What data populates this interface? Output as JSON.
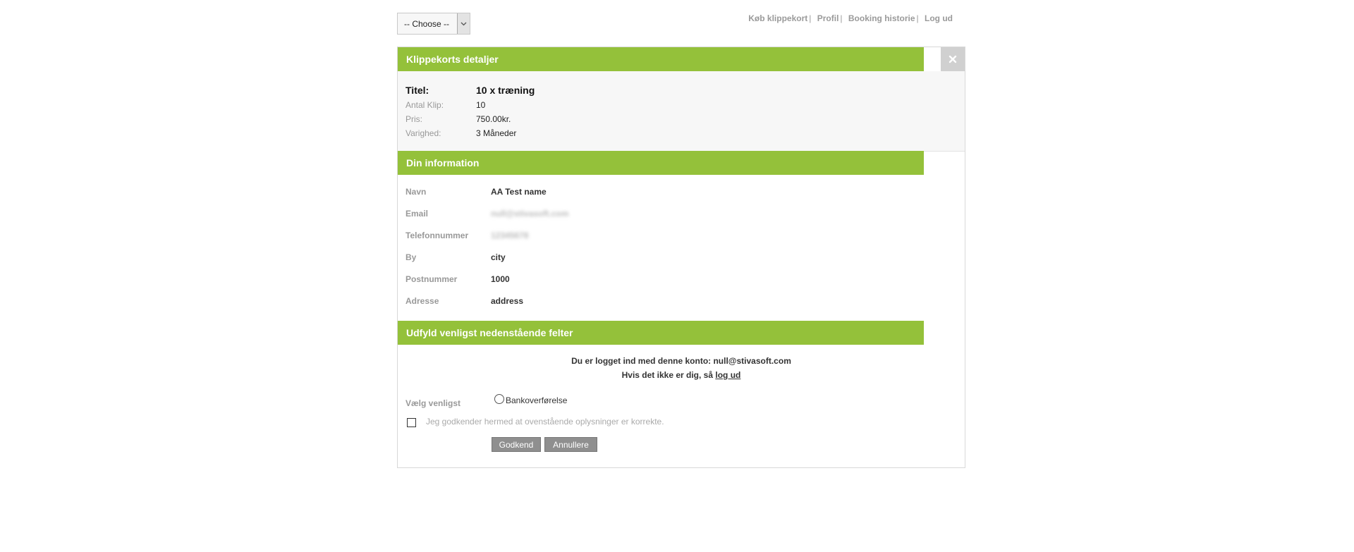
{
  "select": {
    "value": "-- Choose --"
  },
  "nav": {
    "items": [
      {
        "label": "Køb klippekort"
      },
      {
        "label": "Profil"
      },
      {
        "label": "Booking historie"
      },
      {
        "label": "Log ud"
      }
    ],
    "separator": "|"
  },
  "details": {
    "header": "Klippekorts detaljer",
    "title_label": "Titel:",
    "title_value": "10 x træning",
    "rows": [
      {
        "label": "Antal Klip:",
        "value": "10"
      },
      {
        "label": "Pris:",
        "value": "750.00kr."
      },
      {
        "label": "Varighed:",
        "value": "3 Måneder"
      }
    ]
  },
  "info": {
    "header": "Din information",
    "rows": [
      {
        "label": "Navn",
        "value": "AA Test name"
      },
      {
        "label": "Email",
        "value": "null@stivasoft.com"
      },
      {
        "label": "Telefonnummer",
        "value": "12345678"
      },
      {
        "label": "By",
        "value": "city"
      },
      {
        "label": "Postnummer",
        "value": "1000"
      },
      {
        "label": "Adresse",
        "value": "address"
      }
    ]
  },
  "form": {
    "header": "Udfyld venligst nedenstående felter",
    "logged_in_text": "Du er logget ind med denne konto: null@stivasoft.com",
    "not_you_text": "Hvis det ikke er dig, så",
    "logout_link": "log ud",
    "payment_label": "Vælg venligst",
    "payment_option": "Bankoverførelse",
    "terms_text": "Jeg godkender hermed at ovenstående oplysninger er korrekte.",
    "approve_label": "Godkend",
    "cancel_label": "Annullere"
  },
  "colors": {
    "accent": "#94c13a",
    "button": "#8f8f8f"
  }
}
